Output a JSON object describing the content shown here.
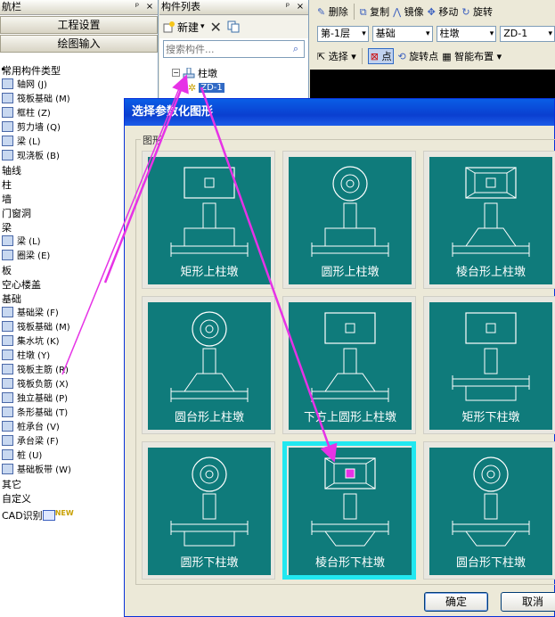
{
  "nav": {
    "title": "航栏",
    "pin": "ᵖ",
    "close": "×",
    "btn_project": "工程设置",
    "btn_draw": "绘图输入",
    "groups": [
      {
        "type": "cat",
        "label": "常用构件类型"
      },
      {
        "type": "item",
        "label": "轴网 (J)"
      },
      {
        "type": "item",
        "label": "筏板基础 (M)"
      },
      {
        "type": "item",
        "label": "框柱 (Z)"
      },
      {
        "type": "item",
        "label": "剪力墙 (Q)"
      },
      {
        "type": "item",
        "label": "梁 (L)"
      },
      {
        "type": "item",
        "label": "现浇板 (B)"
      },
      {
        "type": "cat",
        "label": "轴线"
      },
      {
        "type": "cat",
        "label": "柱"
      },
      {
        "type": "cat",
        "label": "墙"
      },
      {
        "type": "cat",
        "label": "门窗洞"
      },
      {
        "type": "cat",
        "label": "梁"
      },
      {
        "type": "item",
        "label": "梁 (L)"
      },
      {
        "type": "item",
        "label": "圈梁 (E)"
      },
      {
        "type": "cat",
        "label": "板"
      },
      {
        "type": "cat",
        "label": "空心楼盖"
      },
      {
        "type": "cat",
        "label": "基础"
      },
      {
        "type": "item",
        "label": "基础梁 (F)"
      },
      {
        "type": "item",
        "label": "筏板基础 (M)"
      },
      {
        "type": "item",
        "label": "集水坑 (K)"
      },
      {
        "type": "item",
        "label": "柱墩 (Y)"
      },
      {
        "type": "item",
        "label": "筏板主筋 (R)"
      },
      {
        "type": "item",
        "label": "筏板负筋 (X)"
      },
      {
        "type": "item",
        "label": "独立基础 (P)"
      },
      {
        "type": "item",
        "label": "条形基础 (T)"
      },
      {
        "type": "item",
        "label": "桩承台 (V)"
      },
      {
        "type": "item",
        "label": "承台梁 (F)"
      },
      {
        "type": "item",
        "label": "桩 (U)"
      },
      {
        "type": "item",
        "label": "基础板带 (W)"
      },
      {
        "type": "cat",
        "label": "其它"
      },
      {
        "type": "cat",
        "label": "自定义"
      },
      {
        "type": "cad",
        "label": "CAD识别",
        "badge": "NEW"
      }
    ]
  },
  "comp": {
    "title": "构件列表",
    "pin": "ᵖ",
    "close": "×",
    "new_label": "新建",
    "search_placeholder": "搜索构件...",
    "tree_parent": "柱墩",
    "tree_child": "ZD-1"
  },
  "toolbar": {
    "delete": "删除",
    "copy": "复制",
    "mirror": "镜像",
    "move": "移动",
    "rotate": "旋转",
    "floor": "第-1层",
    "category": "基础",
    "type": "柱墩",
    "component": "ZD-1",
    "select": "选择",
    "point": "点",
    "rotate_point": "旋转点",
    "smart_layout": "智能布置"
  },
  "dialog": {
    "title": "选择参数化图形",
    "group": "图形",
    "shapes": [
      "矩形上柱墩",
      "圆形上柱墩",
      "棱台形上柱墩",
      "圆台形上柱墩",
      "下方上圆形上柱墩",
      "矩形下柱墩",
      "圆形下柱墩",
      "棱台形下柱墩",
      "圆台形下柱墩"
    ],
    "selected_index": 7,
    "ok": "确定",
    "cancel": "取消"
  },
  "colors": {
    "tile_bg": "#0f7b7b",
    "selection": "#22e8f0",
    "annotation_arrow": "#e632e6"
  }
}
